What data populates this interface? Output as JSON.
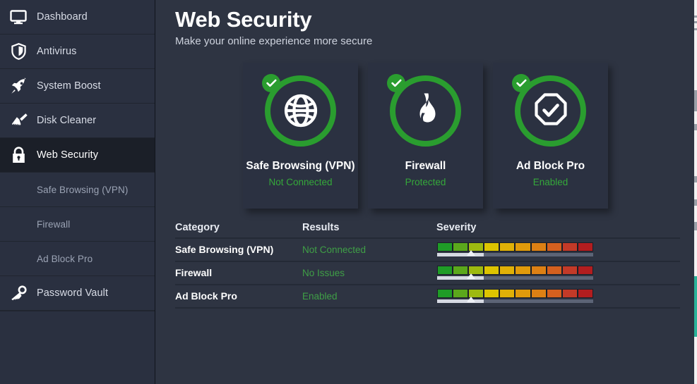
{
  "sidebar": {
    "items": [
      {
        "label": "Dashboard",
        "icon": "monitor-icon",
        "active": false,
        "sub": false
      },
      {
        "label": "Antivirus",
        "icon": "shield-icon",
        "active": false,
        "sub": false
      },
      {
        "label": "System Boost",
        "icon": "rocket-icon",
        "active": false,
        "sub": false
      },
      {
        "label": "Disk Cleaner",
        "icon": "broom-icon",
        "active": false,
        "sub": false
      },
      {
        "label": "Web Security",
        "icon": "padlock-icon",
        "active": true,
        "sub": false
      },
      {
        "label": "Safe Browsing (VPN)",
        "icon": "",
        "active": false,
        "sub": true
      },
      {
        "label": "Firewall",
        "icon": "",
        "active": false,
        "sub": true
      },
      {
        "label": "Ad Block Pro",
        "icon": "",
        "active": false,
        "sub": true
      },
      {
        "label": "Password Vault",
        "icon": "key-icon",
        "active": false,
        "sub": false
      }
    ]
  },
  "header": {
    "title": "Web Security",
    "subtitle": "Make your online experience more secure"
  },
  "cards": [
    {
      "title": "Safe Browsing (VPN)",
      "status": "Not Connected",
      "icon": "globe-icon",
      "badge": "check-icon"
    },
    {
      "title": "Firewall",
      "status": "Protected",
      "icon": "flame-icon",
      "badge": "check-icon"
    },
    {
      "title": "Ad Block Pro",
      "status": "Enabled",
      "icon": "octagon-check-icon",
      "badge": "check-icon"
    }
  ],
  "table": {
    "headers": [
      "Category",
      "Results",
      "Severity"
    ],
    "rows": [
      {
        "category": "Safe Browsing (VPN)",
        "result": "Not Connected",
        "severity_percent": 30
      },
      {
        "category": "Firewall",
        "result": "No Issues",
        "severity_percent": 30
      },
      {
        "category": "Ad Block Pro",
        "result": "Enabled",
        "severity_percent": 30
      }
    ],
    "severity_segments": [
      "#1f9c27",
      "#5ba81c",
      "#9dba10",
      "#ddc400",
      "#e0b007",
      "#e09a0b",
      "#dd8014",
      "#d4601f",
      "#c33a28",
      "#b21d1f"
    ]
  },
  "colors": {
    "accent_green": "#2a9d2f",
    "status_green": "#35a83a",
    "sidebar_bg": "#2a3040",
    "main_bg": "#2e3442",
    "card_bg": "#2b3141",
    "edge_accent": "#2bb39a"
  }
}
